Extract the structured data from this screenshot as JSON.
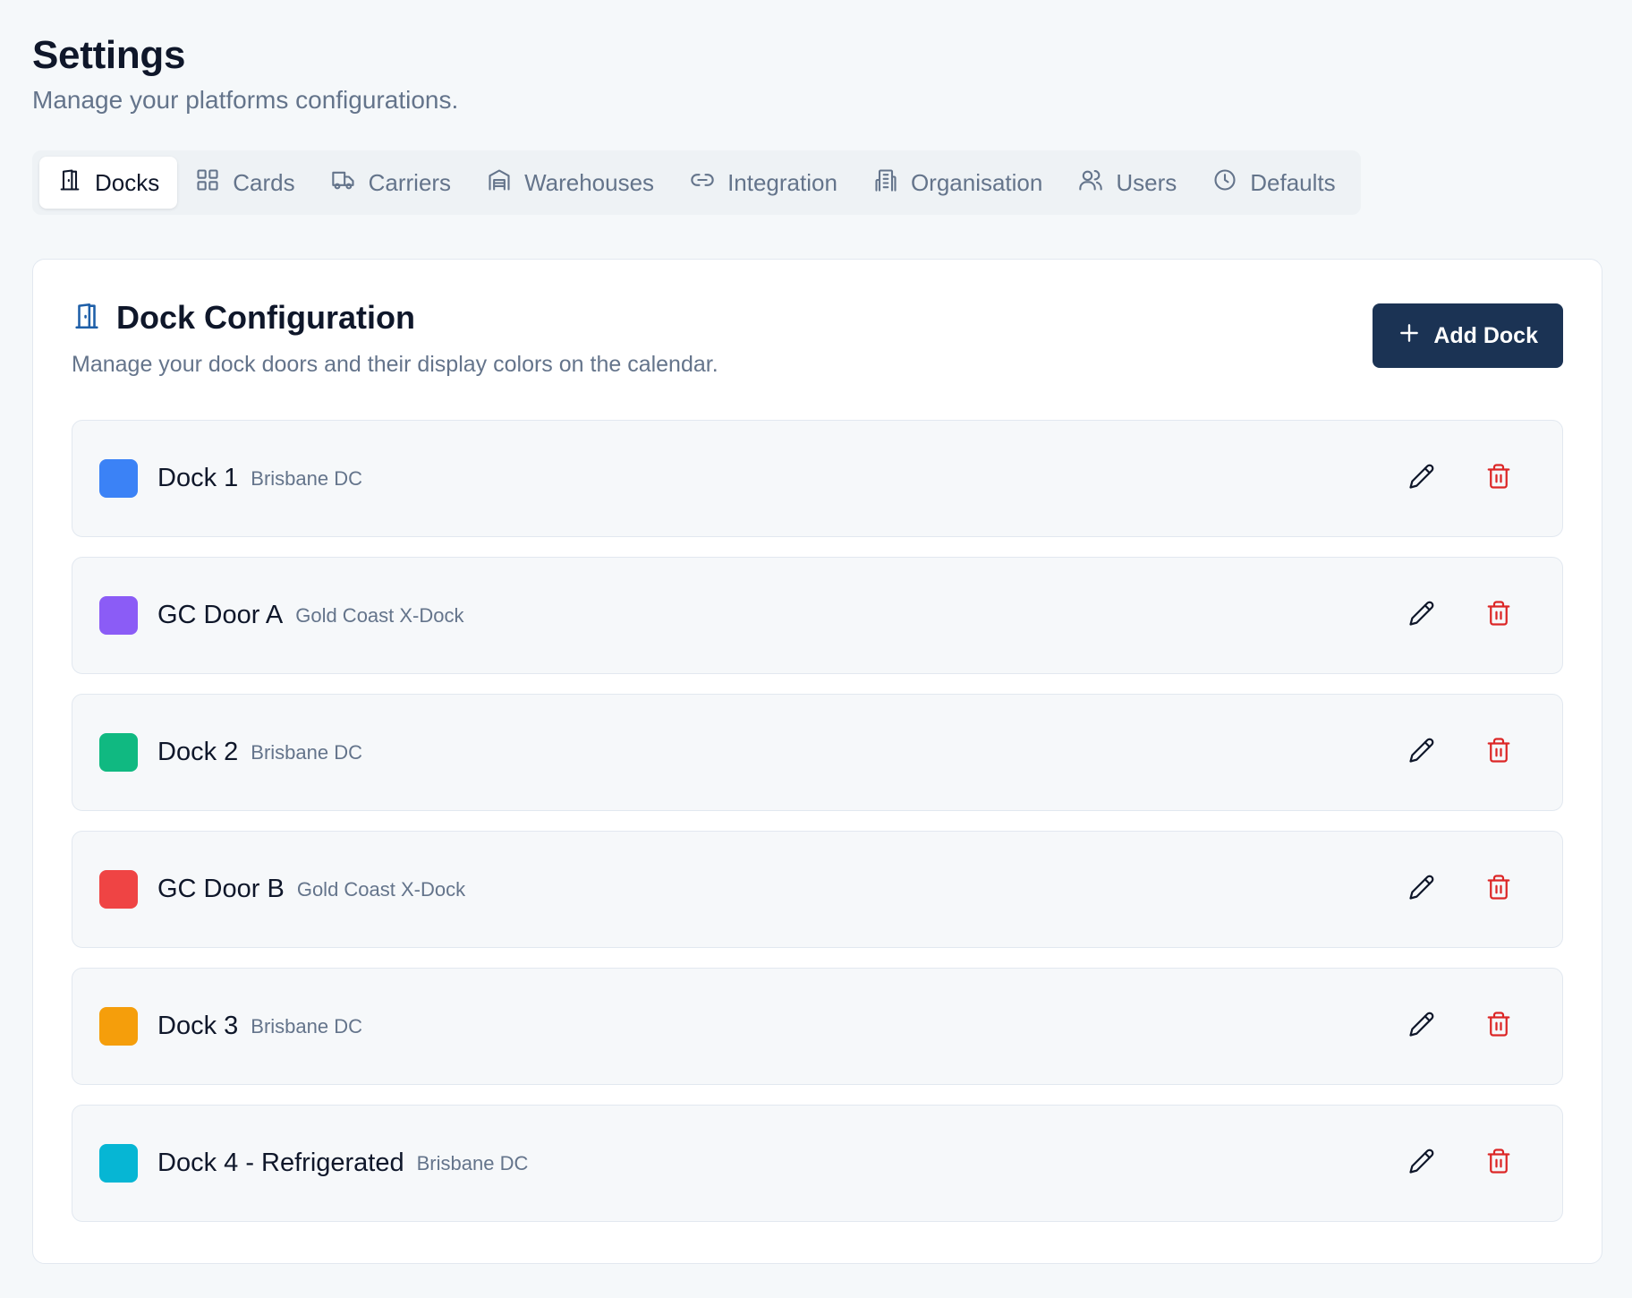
{
  "header": {
    "title": "Settings",
    "subtitle": "Manage your platforms configurations."
  },
  "tabs": [
    {
      "label": "Docks",
      "icon": "door-icon",
      "active": true
    },
    {
      "label": "Cards",
      "icon": "grid-icon",
      "active": false
    },
    {
      "label": "Carriers",
      "icon": "truck-icon",
      "active": false
    },
    {
      "label": "Warehouses",
      "icon": "warehouse-icon",
      "active": false
    },
    {
      "label": "Integration",
      "icon": "link-icon",
      "active": false
    },
    {
      "label": "Organisation",
      "icon": "building-icon",
      "active": false
    },
    {
      "label": "Users",
      "icon": "users-icon",
      "active": false
    },
    {
      "label": "Defaults",
      "icon": "clock-icon",
      "active": false
    }
  ],
  "dock_config": {
    "title": "Dock Configuration",
    "description": "Manage your dock doors and their display colors on the calendar.",
    "add_label": "Add Dock",
    "accent_color": "#1e5fa8",
    "button_color": "#1b3354"
  },
  "docks": [
    {
      "name": "Dock 1",
      "location": "Brisbane DC",
      "color": "#3b82f6"
    },
    {
      "name": "GC Door A",
      "location": "Gold Coast X-Dock",
      "color": "#8b5cf6"
    },
    {
      "name": "Dock 2",
      "location": "Brisbane DC",
      "color": "#10b981"
    },
    {
      "name": "GC Door B",
      "location": "Gold Coast X-Dock",
      "color": "#ef4444"
    },
    {
      "name": "Dock 3",
      "location": "Brisbane DC",
      "color": "#f59e0b"
    },
    {
      "name": "Dock 4 - Refrigerated",
      "location": "Brisbane DC",
      "color": "#06b6d4"
    }
  ]
}
